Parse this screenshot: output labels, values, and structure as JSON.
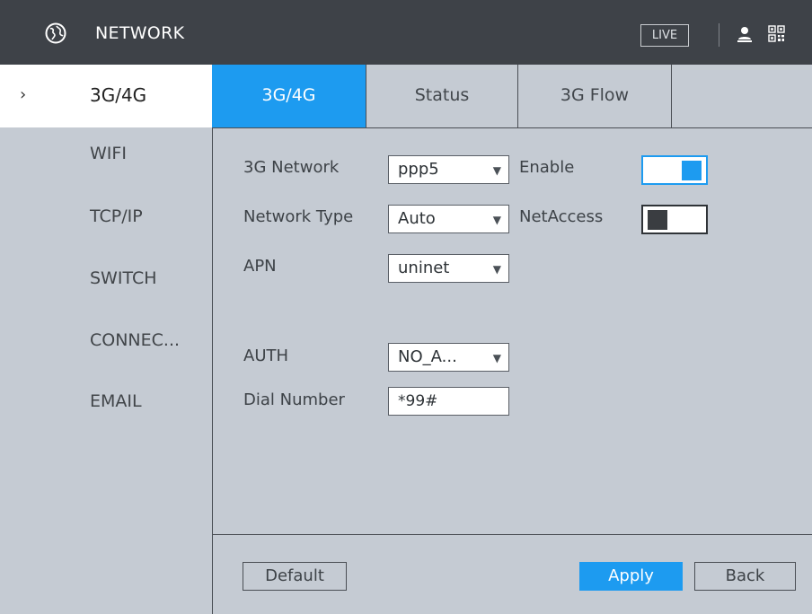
{
  "header": {
    "title": "NETWORK",
    "live_label": "LIVE",
    "icons": [
      "globe-icon",
      "user-icon",
      "qr-code-icon"
    ]
  },
  "sidebar": {
    "items": [
      {
        "label": "3G/4G",
        "active": true
      },
      {
        "label": "WIFI"
      },
      {
        "label": "TCP/IP"
      },
      {
        "label": "SWITCH"
      },
      {
        "label": "CONNEC..."
      },
      {
        "label": "EMAIL"
      }
    ]
  },
  "tabs": [
    {
      "label": "3G/4G",
      "active": true
    },
    {
      "label": "Status"
    },
    {
      "label": "3G Flow"
    }
  ],
  "form": {
    "network": {
      "label": "3G Network",
      "value": "ppp5"
    },
    "enable": {
      "label": "Enable",
      "on": true
    },
    "network_type": {
      "label": "Network Type",
      "value": "Auto"
    },
    "netaccess": {
      "label": "NetAccess",
      "on": false
    },
    "apn": {
      "label": "APN",
      "value": "uninet"
    },
    "auth": {
      "label": "AUTH",
      "value": "NO_A..."
    },
    "dial_number": {
      "label": "Dial Number",
      "value": "*99#"
    }
  },
  "buttons": {
    "default": "Default",
    "apply": "Apply",
    "back": "Back"
  },
  "colors": {
    "header_bg": "#3e4248",
    "panel_bg": "#c5cbd3",
    "accent": "#1d9bf0"
  }
}
